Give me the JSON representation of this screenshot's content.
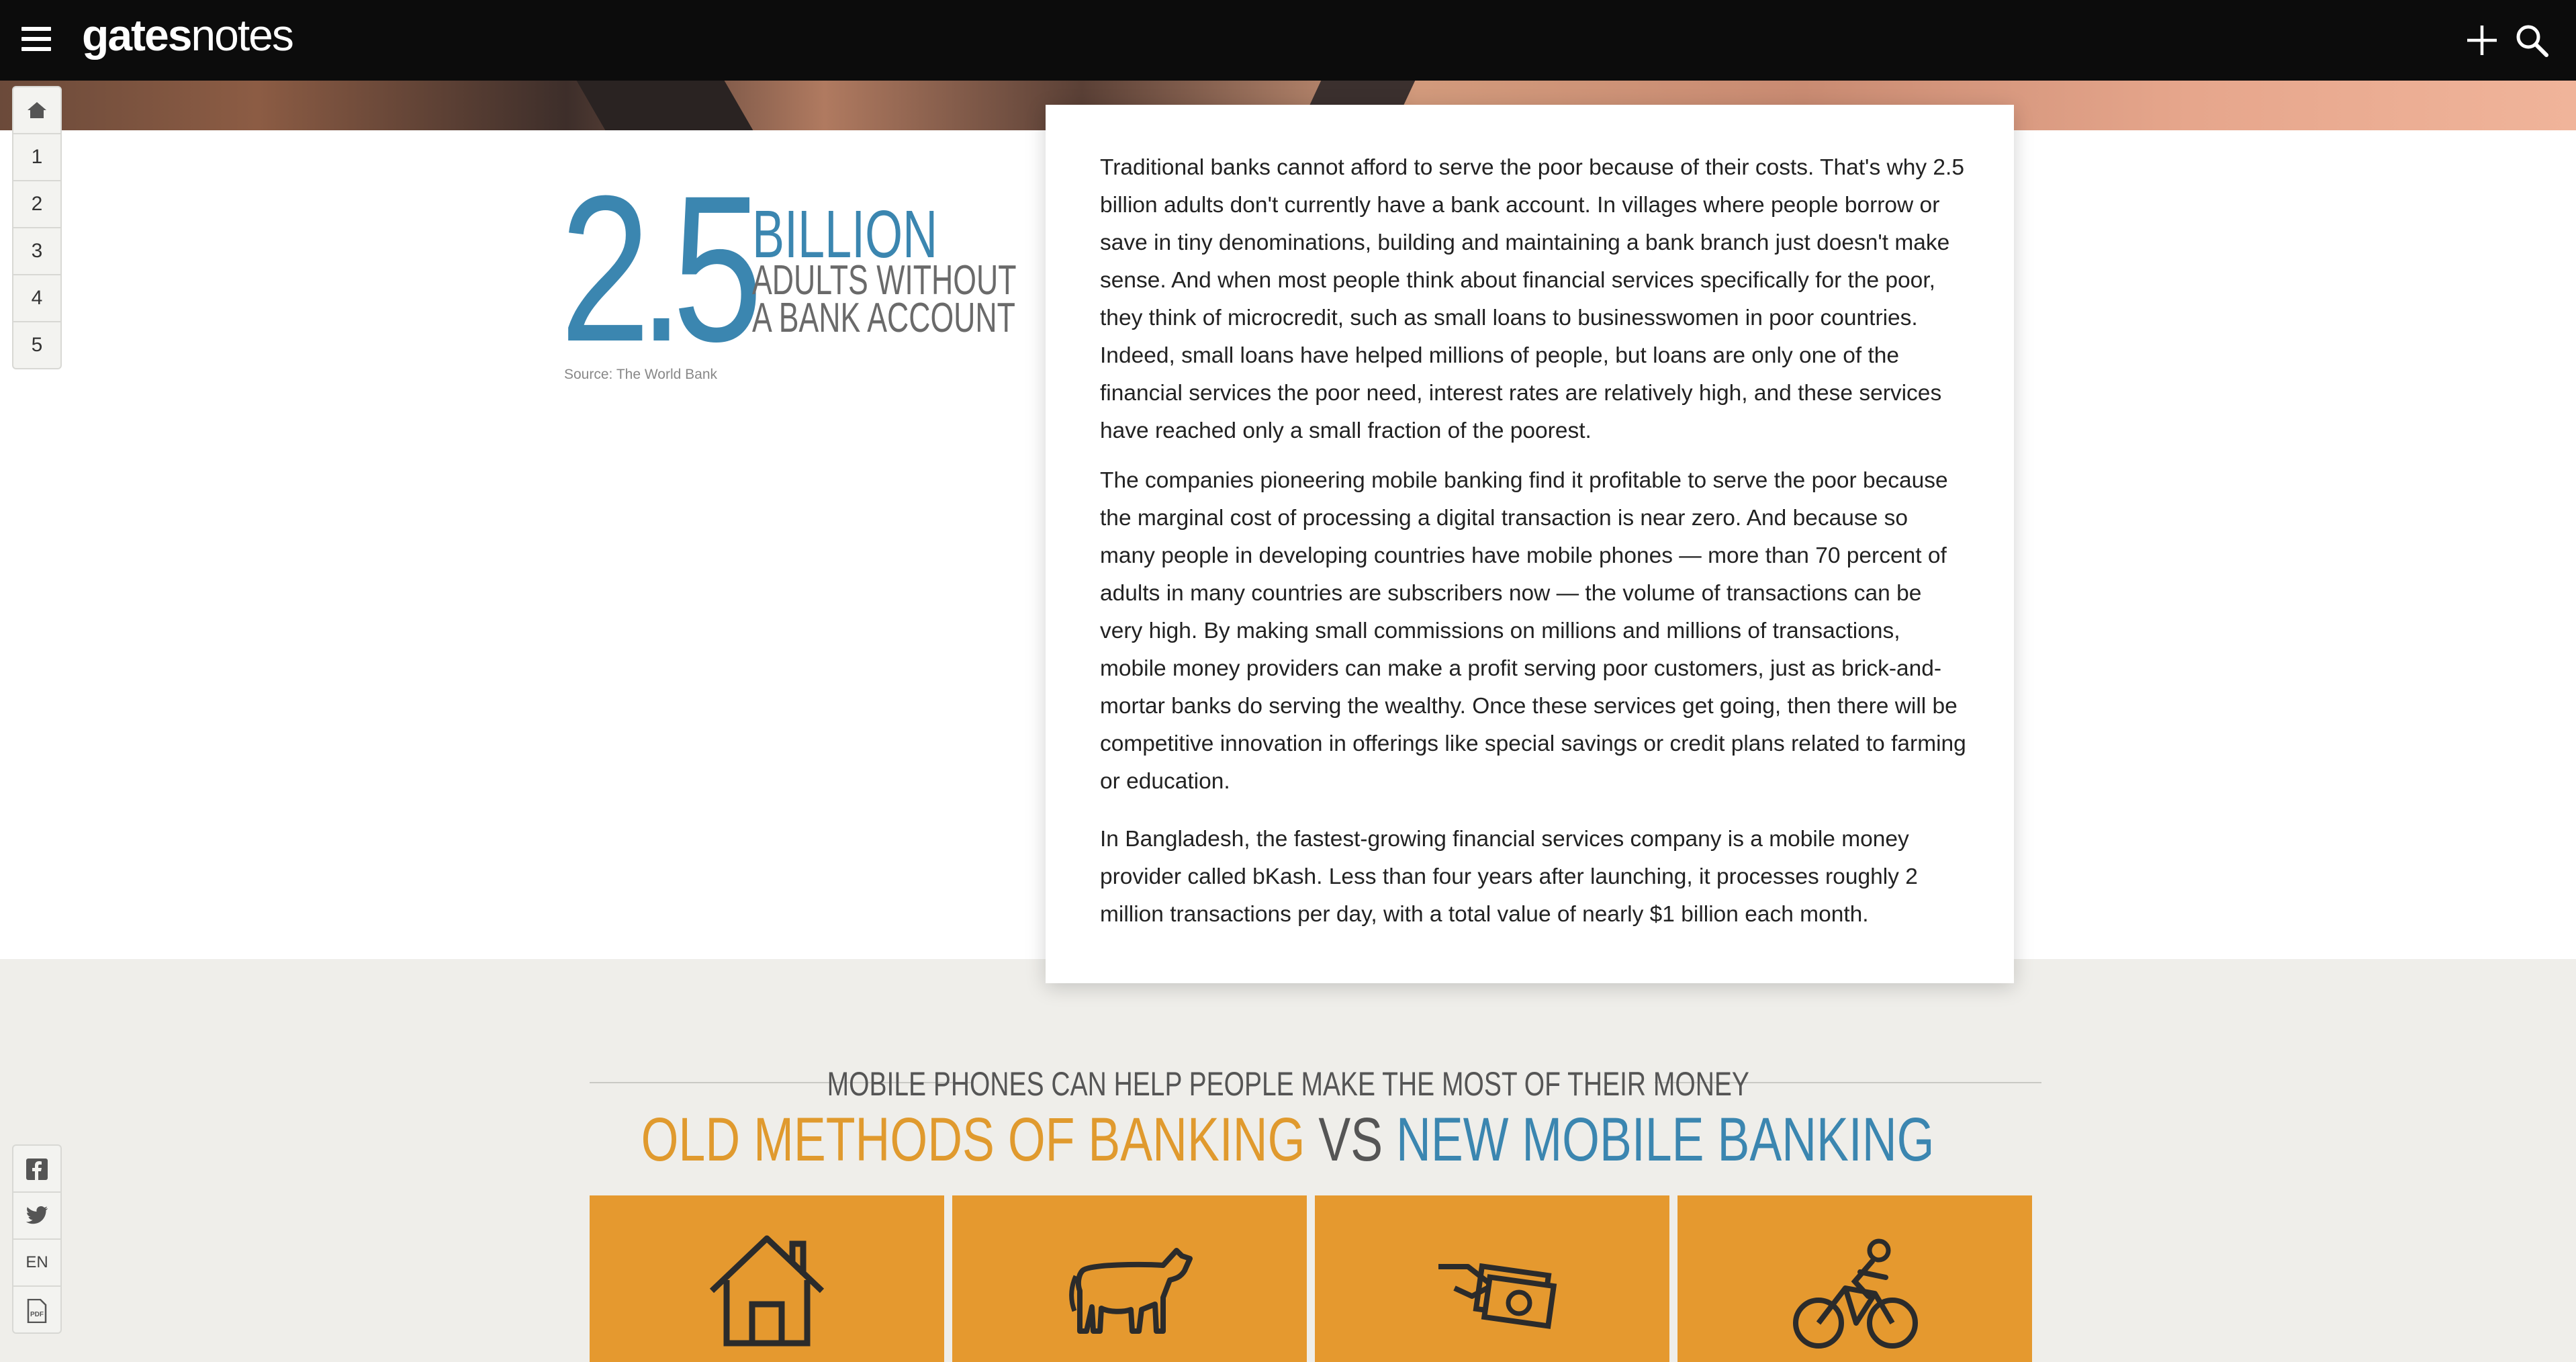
{
  "header": {
    "logo_bold": "gates",
    "logo_thin": "notes"
  },
  "sidenav": {
    "items": [
      "1",
      "2",
      "3",
      "4",
      "5"
    ]
  },
  "sharebar": {
    "language": "EN",
    "pdf": "PDF"
  },
  "stat": {
    "number": "2.5",
    "unit": "BILLION",
    "desc_line1": "ADULTS WITHOUT",
    "desc_line2": "A BANK ACCOUNT",
    "source": "Source: The World Bank"
  },
  "article": {
    "paragraphs": [
      "Traditional banks cannot afford to serve the poor because of their costs. That's why 2.5 billion adults don't currently have a bank account. In villages where people borrow or save in tiny denominations, building and maintaining a bank branch just doesn't make sense. And when most people think about financial services specifically for the poor, they think of microcredit, such as small loans to businesswomen in poor countries. Indeed, small loans have helped millions of people, but loans are only one of the financial services the poor need, interest rates are relatively high, and these services have reached only a small fraction of the poorest.",
      "The companies pioneering mobile banking find it profitable to serve the poor because the marginal cost of processing a digital transaction is near zero. And because so many people in developing countries have mobile phones — more than 70 percent of adults in many countries are subscribers now — the volume of transactions can be very high. By making small commissions on millions and millions of transactions, mobile money providers can make a profit serving poor customers, just as brick-and-mortar banks do serving the wealthy. Once these services get going, then there will be competitive innovation in offerings like special savings or credit plans related to farming or education.",
      "In Bangladesh, the fastest-growing financial services company is a mobile money provider called bKash. Less than four years after launching, it processes roughly 2 million transactions per day, with a total value of nearly $1 billion each month."
    ]
  },
  "infographic": {
    "kicker": "MOBILE PHONES CAN HELP PEOPLE MAKE THE MOST OF THEIR MONEY",
    "old": "OLD METHODS OF BANKING",
    "vs": "VS",
    "new": "NEW MOBILE BANKING",
    "tiles": [
      "house-icon",
      "cow-icon",
      "cash-hand-icon",
      "cyclist-icon"
    ],
    "tile_color": "#e5992f",
    "old_color": "#e09a2e",
    "new_color": "#3b86b0"
  }
}
